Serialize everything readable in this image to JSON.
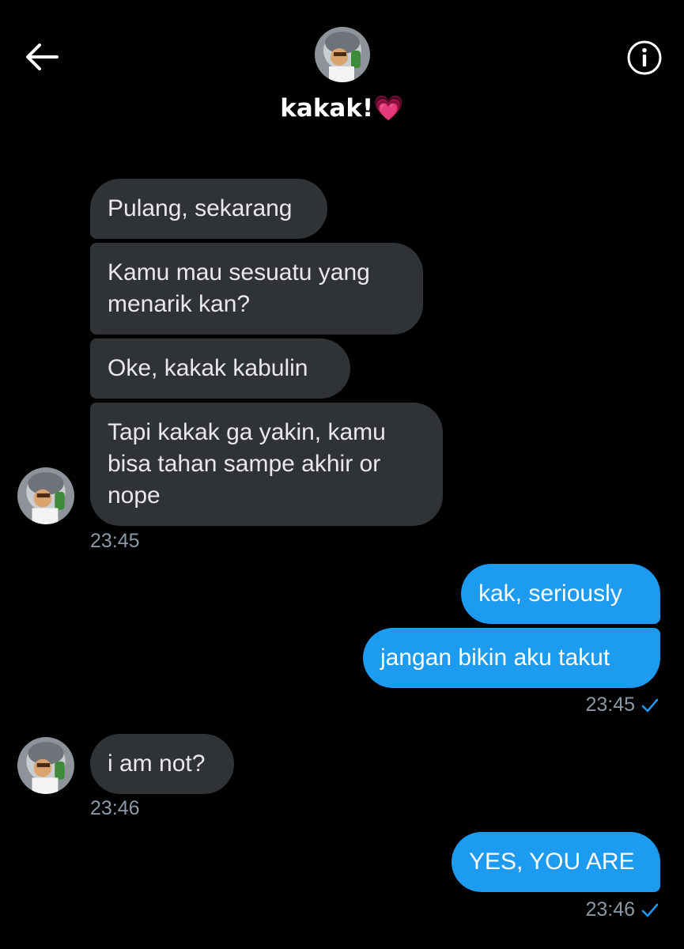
{
  "header": {
    "title": "kakak!💗"
  },
  "messages": {
    "m1": "Pulang, sekarang",
    "m2_line1": "Kamu mau sesuatu yang",
    "m2_line2": "menarik kan?",
    "m3": "Oke, kakak kabulin",
    "m4_line1": "Tapi kakak ga yakin, kamu",
    "m4_line2": "bisa tahan sampe akhir or",
    "m4_line3": "nope",
    "t1": "23:45",
    "m5": "kak, seriously",
    "m6": "jangan bikin aku takut",
    "t2": "23:45",
    "m7": "i am not?",
    "t3": "23:46",
    "m8": "YES, YOU ARE",
    "t4": "23:46"
  },
  "colors": {
    "background": "#000000",
    "incoming_bubble": "#2f3336",
    "outgoing_bubble": "#1d9bf0",
    "timestamp": "#8b98a5",
    "read_check": "#1d9bf0"
  },
  "icons": {
    "back": "back-arrow-icon",
    "info": "info-icon",
    "read": "check-icon"
  }
}
